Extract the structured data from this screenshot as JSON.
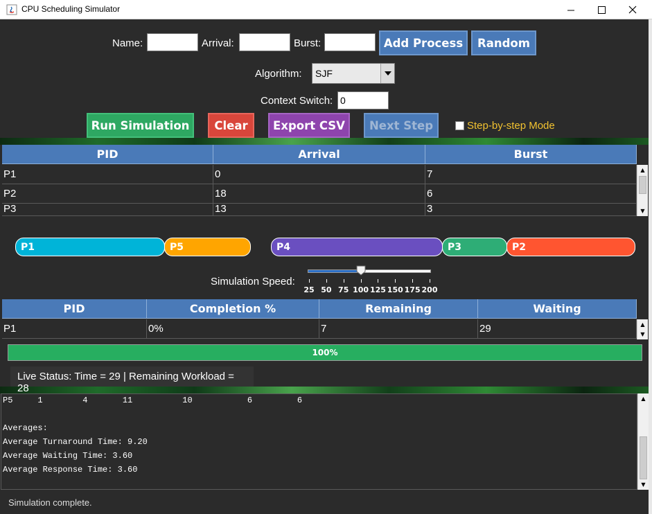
{
  "window": {
    "title": "CPU Scheduling Simulator"
  },
  "inputs": {
    "name_label": "Name:",
    "name_value": "",
    "arrival_label": "Arrival:",
    "arrival_value": "",
    "burst_label": "Burst:",
    "burst_value": "",
    "add_process_label": "Add Process",
    "random_label": "Random",
    "algorithm_label": "Algorithm:",
    "algorithm_value": "SJF",
    "context_switch_label": "Context Switch:",
    "context_switch_value": "0"
  },
  "actions": {
    "run_label": "Run Simulation",
    "clear_label": "Clear",
    "export_label": "Export CSV",
    "next_step_label": "Next Step",
    "step_mode_label": "Step-by-step Mode",
    "step_mode_checked": false
  },
  "process_table": {
    "headers": [
      "PID",
      "Arrival",
      "Burst"
    ],
    "rows": [
      [
        "P1",
        "0",
        "7"
      ],
      [
        "P2",
        "18",
        "6"
      ],
      [
        "P3",
        "13",
        "3"
      ]
    ]
  },
  "gantt": {
    "segments": [
      {
        "label": "P1",
        "color": "#00b4d8"
      },
      {
        "label": "P5",
        "color": "#ffa500"
      },
      {
        "label": "P4",
        "color": "#6a4fc0"
      },
      {
        "label": "P3",
        "color": "#2ead76"
      },
      {
        "label": "P2",
        "color": "#ff5530"
      }
    ]
  },
  "speed": {
    "label": "Simulation Speed:",
    "ticks": [
      "25",
      "50",
      "75",
      "100",
      "125",
      "150",
      "175",
      "200"
    ],
    "value": 100
  },
  "stats_table": {
    "headers": [
      "PID",
      "Completion %",
      "Remaining",
      "Waiting"
    ],
    "rows": [
      [
        "P1",
        "0%",
        "7",
        "29"
      ]
    ]
  },
  "progress": {
    "value": 100,
    "text": "100%"
  },
  "live_status": "Live Status: Time = 29 | Remaining Workload = 28",
  "console": {
    "lines": [
      "P5     1        4       11          10           6         6",
      "",
      "Averages:",
      "Average Turnaround Time: 9.20",
      "Average Waiting Time: 3.60",
      "Average Response Time: 3.60"
    ]
  },
  "status_bar": "Simulation complete.",
  "colors": {
    "accent_blue": "#4a7ab8",
    "run_green": "#2ea862",
    "clear_red": "#d9463b",
    "export_purple": "#8e44ad",
    "step_mode_text": "#f2c230"
  }
}
